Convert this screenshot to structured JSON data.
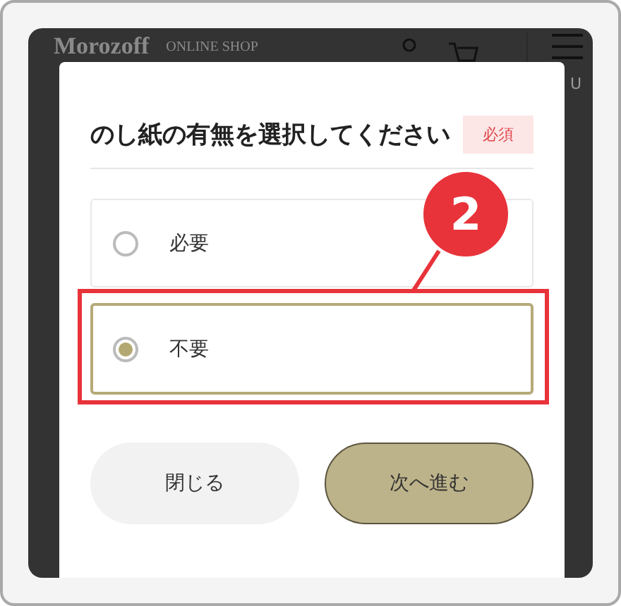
{
  "header": {
    "logo": "Morozoff",
    "subtitle": "ONLINE SHOP",
    "menu_label": "U"
  },
  "dialog": {
    "title": "のし紙の有無を選択してください",
    "badge": "必須",
    "options": [
      {
        "label": "必要",
        "selected": false
      },
      {
        "label": "不要",
        "selected": true
      }
    ],
    "buttons": [
      {
        "label": "閉じる",
        "kind": "secondary"
      },
      {
        "label": "次へ進む",
        "kind": "primary"
      }
    ]
  },
  "callout": {
    "label": "2"
  }
}
